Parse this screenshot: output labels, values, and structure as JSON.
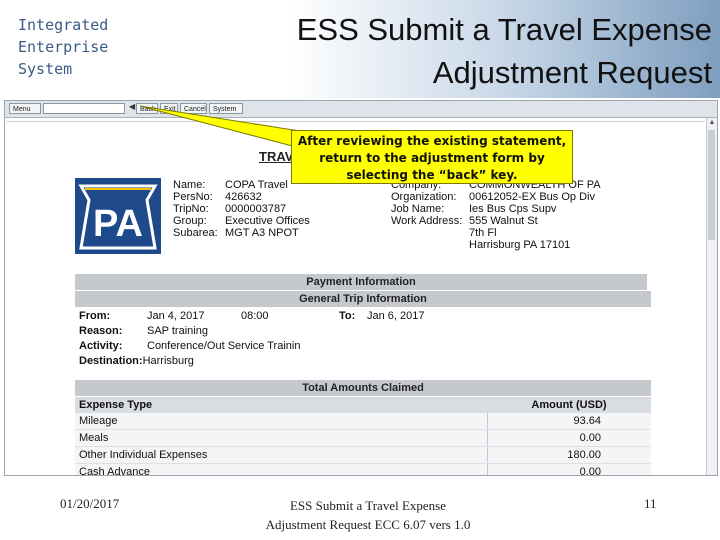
{
  "header": {
    "brand_lines": [
      "Integrated",
      "Enterprise",
      "System"
    ],
    "title_lines": [
      "ESS Submit a Travel Expense",
      "Adjustment Request"
    ]
  },
  "toolbar": {
    "menu_label": "Menu",
    "back_label": "Back",
    "exit_label": "Exit",
    "cancel_label": "Cancel",
    "system_label": "System"
  },
  "statement": {
    "heading_partial": "TRAV",
    "logo_text": "PA",
    "employee": {
      "name_label": "Name:",
      "name": "COPA Travel",
      "persno_label": "PersNo:",
      "persno": "426632",
      "tripno_label": "TripNo:",
      "tripno": "0000003787",
      "group_label": "Group:",
      "group": "Executive Offices",
      "subarea_label": "Subarea:",
      "subarea": "MGT A3 NPOT"
    },
    "company": {
      "company_label": "Company:",
      "company": "COMMONWEALTH OF PA",
      "org_label": "Organization:",
      "org": "00612052-EX Bus Op Div",
      "job_label": "Job Name:",
      "job": "Ies Bus Cps Supv",
      "work_label": "Work Address:",
      "work_lines": [
        "555 Walnut St",
        "7th Fl",
        "Harrisburg PA 17101"
      ]
    },
    "payment_band": "Payment Information",
    "trip_band": "General Trip Information",
    "trip": {
      "from_label": "From:",
      "from_date": "Jan 4, 2017",
      "from_time": "08:00",
      "to_label": "To:",
      "to_date": "Jan 6, 2017",
      "reason_label": "Reason:",
      "reason": "SAP training",
      "activity_label": "Activity:",
      "activity": "Conference/Out Service Trainin",
      "destination_label": "Destination:",
      "destination": "Harrisburg"
    },
    "totals_band": "Total Amounts Claimed",
    "totals_headers": [
      "Expense Type",
      "Amount (USD)"
    ],
    "totals_rows": [
      {
        "type": "Mileage",
        "amount": "93.64"
      },
      {
        "type": "Meals",
        "amount": "0.00"
      },
      {
        "type": "Other Individual Expenses",
        "amount": "180.00"
      },
      {
        "type": "Cash Advance",
        "amount": "0.00"
      }
    ]
  },
  "callout": {
    "lines": [
      "After reviewing the existing statement,",
      "return to the adjustment form by",
      "selecting the “back” key."
    ]
  },
  "footer": {
    "date": "01/20/2017",
    "center_lines": [
      "ESS Submit a Travel Expense",
      "Adjustment Request ECC 6.07 vers 1.0"
    ],
    "page_number": "11"
  },
  "colors": {
    "callout": "#ffff00",
    "band": "#c5c9ce",
    "logo_blue": "#1e4a8c",
    "logo_gold": "#f5c400"
  }
}
